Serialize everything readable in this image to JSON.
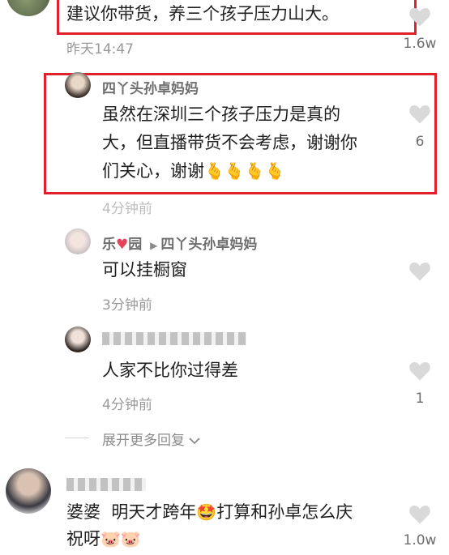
{
  "comments": [
    {
      "text": "建议你带货，养三个孩子压力山大。",
      "time": "昨天14:47",
      "likes": "1.6w"
    },
    {
      "username": "四丫头孙卓妈妈",
      "text_line1": "虽然在深圳三个孩子压力是真的",
      "text_line2": "大，但直播带货不会考虑，谢谢你",
      "text_line3": "们关心，谢谢",
      "text_line3_emoji": "🫰🫰🫰🫰",
      "time": "4分钟前",
      "likes": "6"
    },
    {
      "username": "乐",
      "username_heart": "♥",
      "username_tail": "园",
      "reply_arrow": "▶",
      "reply_to": "四丫头孙卓妈妈",
      "text": "可以挂橱窗",
      "time": "3分钟前",
      "likes": ""
    },
    {
      "text": "人家不比你过得差",
      "time": "4分钟前",
      "likes": "1"
    },
    {
      "text_part1": "婆婆  明天才跨年",
      "text_emoji": "🤩",
      "text_part2": "打算和孙卓怎么庆",
      "text_line2": "祝呀",
      "text_line2_emoji": "🐷🐷",
      "likes": "1.0w"
    }
  ],
  "expand_more": "展开更多回复",
  "expand_icon": "chevron-down-icon",
  "colors": {
    "highlight": "#e0212c",
    "meta_text": "#9a9a9a",
    "heart": "#d9d9d9",
    "username_heart": "#e8415a"
  }
}
